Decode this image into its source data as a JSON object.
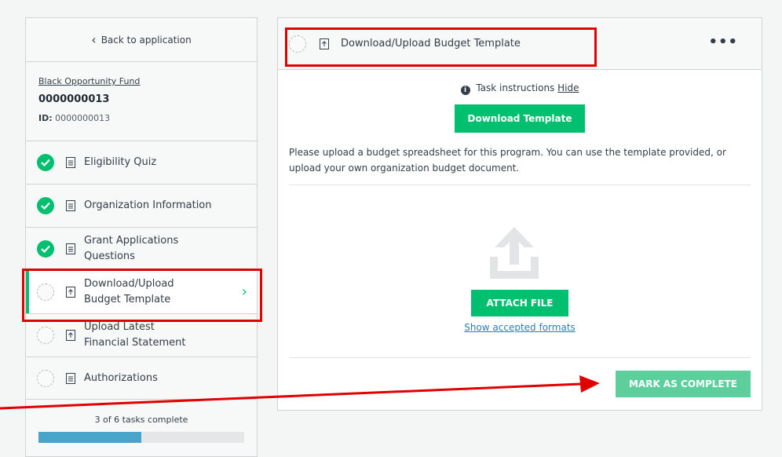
{
  "sidebar": {
    "back_label": "Back to application",
    "fund_name": "Black Opportunity Fund",
    "app_number": "0000000013",
    "id_label": "ID:",
    "id_value": "0000000013",
    "tasks": [
      {
        "label": "Eligibility Quiz",
        "status": "complete",
        "icon": "document-icon"
      },
      {
        "label": "Organization Information",
        "status": "complete",
        "icon": "document-icon"
      },
      {
        "label": "Grant Applications Questions",
        "status": "complete",
        "icon": "document-icon"
      },
      {
        "label": "Download/Upload Budget Template",
        "status": "pending",
        "icon": "upload-file-icon",
        "active": true
      },
      {
        "label": "Upload Latest Financial Statement",
        "status": "pending",
        "icon": "upload-file-icon"
      },
      {
        "label": "Authorizations",
        "status": "pending",
        "icon": "document-icon"
      }
    ],
    "progress_text": "3 of 6 tasks complete",
    "progress_fraction": 0.5
  },
  "main": {
    "title": "Download/Upload Budget Template",
    "more_label": "•••",
    "instructions_label": "Task instructions",
    "hide_label": "Hide",
    "download_button": "Download Template",
    "description": "Please upload a budget spreadsheet for this program. You can use the template provided, or upload your own organization budget document.",
    "attach_button": "ATTACH FILE",
    "formats_link": "Show accepted formats",
    "complete_button": "MARK AS COMPLETE"
  },
  "colors": {
    "accent_green": "#00bf6f",
    "complete_button_green": "#5ccf9d",
    "progress_blue": "#48a5c9",
    "annotation_red": "#e00000",
    "link_blue": "#2b7fb4"
  }
}
